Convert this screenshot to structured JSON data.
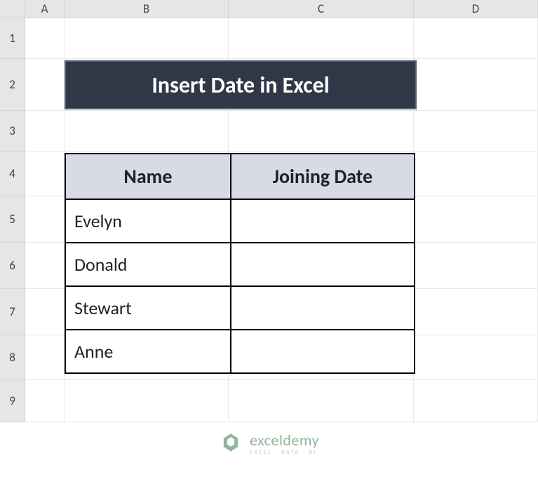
{
  "columns": [
    "A",
    "B",
    "C",
    "D"
  ],
  "rows": [
    "1",
    "2",
    "3",
    "4",
    "5",
    "6",
    "7",
    "8",
    "9"
  ],
  "title": "Insert Date in Excel",
  "table": {
    "headers": [
      "Name",
      "Joining Date"
    ],
    "data": [
      {
        "name": "Evelyn",
        "date": ""
      },
      {
        "name": "Donald",
        "date": ""
      },
      {
        "name": "Stewart",
        "date": ""
      },
      {
        "name": "Anne",
        "date": ""
      }
    ]
  },
  "watermark": {
    "main": "exceldemy",
    "sub": "EXCEL · DATA · BI"
  }
}
